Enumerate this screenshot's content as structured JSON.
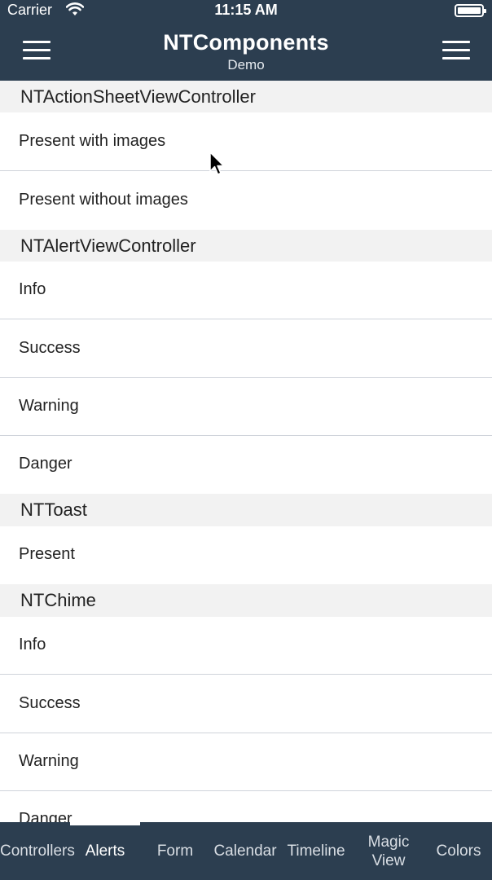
{
  "status_bar": {
    "carrier": "Carrier",
    "time": "11:15 AM",
    "wifi_icon": "wifi-icon",
    "battery_icon": "battery-icon"
  },
  "nav": {
    "title": "NTComponents",
    "subtitle": "Demo",
    "left_icon": "hamburger-menu-icon",
    "right_icon": "hamburger-menu-icon"
  },
  "sections": [
    {
      "header": "NTActionSheetViewController",
      "rows": [
        "Present with images",
        "Present without images"
      ]
    },
    {
      "header": "NTAlertViewController",
      "rows": [
        "Info",
        "Success",
        "Warning",
        "Danger"
      ]
    },
    {
      "header": "NTToast",
      "rows": [
        "Present"
      ]
    },
    {
      "header": "NTChime",
      "rows": [
        "Info",
        "Success",
        "Warning",
        "Danger"
      ]
    }
  ],
  "tabs": [
    {
      "label": "Controllers",
      "active": false
    },
    {
      "label": "Alerts",
      "active": true
    },
    {
      "label": "Form",
      "active": false
    },
    {
      "label": "Calendar",
      "active": false
    },
    {
      "label": "Timeline",
      "active": false
    },
    {
      "label": "Magic View",
      "active": false
    },
    {
      "label": "Colors",
      "active": false
    }
  ],
  "colors": {
    "bar_background": "#2c3e50",
    "section_header_background": "#f2f2f2",
    "separator": "#cfd3da"
  }
}
